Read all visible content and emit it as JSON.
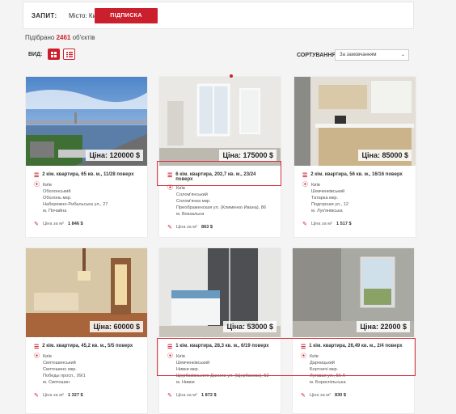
{
  "query": {
    "label": "ЗАПИТ:",
    "city_label": "Місто:",
    "city": "Київ",
    "subscribe": "ПІДПИСКА"
  },
  "results": {
    "prefix": "Підібрано",
    "count": "2461",
    "suffix": "об'єктів"
  },
  "view": {
    "label": "ВИД:"
  },
  "sort": {
    "label": "СОРТУВАННЯ:",
    "value": "За замовчанням"
  },
  "listings": [
    {
      "price": "Ціна: 120000 $",
      "title": "2 кім. квартира, 65 кв. м., 11/28 поверх",
      "city": "Київ",
      "district": "Оболонський",
      "micro": "Оболонь мкр.",
      "street": "Набережно-Рибальська ул., 27",
      "metro": "м. Почайна",
      "ppm_label": "Ціна за м²",
      "ppm": "1 846 $"
    },
    {
      "price": "Ціна: 175000 $",
      "title": "6 кім. квартира, 202,7 кв. м., 23/24 поверх",
      "city": "Київ",
      "district": "Солом'янський",
      "micro": "Солом'янка мкр.",
      "street": "Преображенская ул. (Клименко Ивана), 86",
      "metro": "м. Вокзальна",
      "ppm_label": "Ціна за м²",
      "ppm": "863 $"
    },
    {
      "price": "Ціна: 85000 $",
      "title": "2 кім. квартира, 56 кв. м., 16/16 поверх",
      "city": "Київ",
      "district": "Шевченківський",
      "micro": "Татарка мкр.",
      "street": "Подгорная ул., 12",
      "metro": "м. Лук'янівська",
      "ppm_label": "Ціна за м²",
      "ppm": "1 517 $"
    },
    {
      "price": "Ціна: 60000 $",
      "title": "2 кім. квартира, 45,2 кв. м., 5/5 поверх",
      "city": "Київ",
      "district": "Святошинський",
      "micro": "Святошино мкр.",
      "street": "Победы просп., 99/1",
      "metro": "м. Святошин",
      "ppm_label": "Ціна за м²",
      "ppm": "1 327 $"
    },
    {
      "price": "Ціна: 53000 $",
      "title": "1 кім. квартира, 28,3 кв. м., 6/19 поверх",
      "city": "Київ",
      "district": "Шевченківський",
      "micro": "Нивки мкр.",
      "street": "Щербаківського Данила ул. (Щербакова), 52",
      "metro": "м. Нивки",
      "ppm_label": "Ціна за м²",
      "ppm": "1 872 $"
    },
    {
      "price": "Ціна: 22000 $",
      "title": "1 кім. квартира, 26,49 кв. м., 2/4 поверх",
      "city": "Київ",
      "district": "Дарницький",
      "micro": "Бортничі мкр.",
      "street": "Луговая ул., 56 А",
      "metro": "м. Бориспільська",
      "ppm_label": "Ціна за м²",
      "ppm": "830 $"
    }
  ]
}
